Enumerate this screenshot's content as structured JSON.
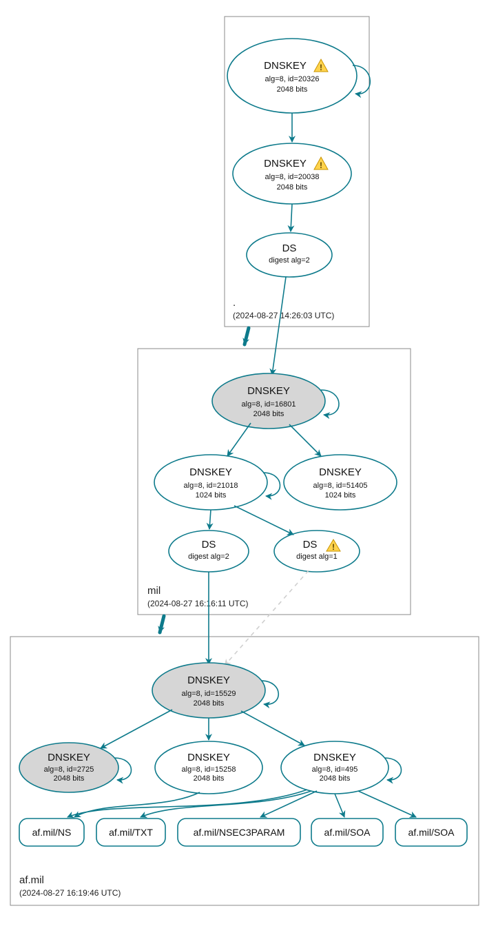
{
  "zones": {
    "root": {
      "name": ".",
      "timestamp": "(2024-08-27 14:26:03 UTC)"
    },
    "mil": {
      "name": "mil",
      "timestamp": "(2024-08-27 16:16:11 UTC)"
    },
    "afmil": {
      "name": "af.mil",
      "timestamp": "(2024-08-27 16:19:46 UTC)"
    }
  },
  "nodes": {
    "root_ksk": {
      "title": "DNSKEY",
      "line2": "alg=8, id=20326",
      "line3": "2048 bits",
      "warn": true
    },
    "root_zsk": {
      "title": "DNSKEY",
      "line2": "alg=8, id=20038",
      "line3": "2048 bits",
      "warn": true
    },
    "root_ds": {
      "title": "DS",
      "line2": "digest alg=2"
    },
    "mil_ksk": {
      "title": "DNSKEY",
      "line2": "alg=8, id=16801",
      "line3": "2048 bits"
    },
    "mil_zsk1": {
      "title": "DNSKEY",
      "line2": "alg=8, id=21018",
      "line3": "1024 bits"
    },
    "mil_zsk2": {
      "title": "DNSKEY",
      "line2": "alg=8, id=51405",
      "line3": "1024 bits"
    },
    "mil_ds1": {
      "title": "DS",
      "line2": "digest alg=2"
    },
    "mil_ds2": {
      "title": "DS",
      "line2": "digest alg=1",
      "warn": true
    },
    "af_ksk": {
      "title": "DNSKEY",
      "line2": "alg=8, id=15529",
      "line3": "2048 bits"
    },
    "af_k1": {
      "title": "DNSKEY",
      "line2": "alg=8, id=2725",
      "line3": "2048 bits"
    },
    "af_k2": {
      "title": "DNSKEY",
      "line2": "alg=8, id=15258",
      "line3": "2048 bits"
    },
    "af_k3": {
      "title": "DNSKEY",
      "line2": "alg=8, id=495",
      "line3": "2048 bits"
    }
  },
  "rr": {
    "ns": "af.mil/NS",
    "txt": "af.mil/TXT",
    "nsec3": "af.mil/NSEC3PARAM",
    "soa1": "af.mil/SOA",
    "soa2": "af.mil/SOA"
  }
}
